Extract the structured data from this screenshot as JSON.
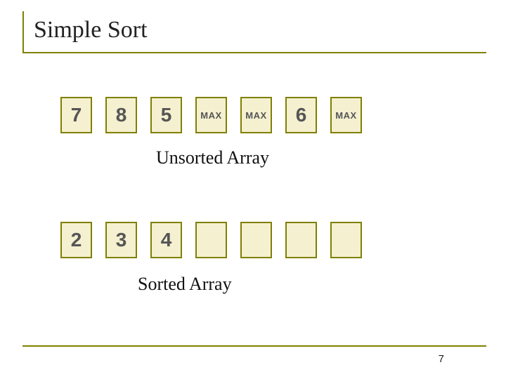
{
  "title": "Simple Sort",
  "unsorted": {
    "caption": "Unsorted Array",
    "cells": [
      {
        "kind": "num",
        "value": "7"
      },
      {
        "kind": "num",
        "value": "8"
      },
      {
        "kind": "num",
        "value": "5"
      },
      {
        "kind": "max",
        "value": "MAX"
      },
      {
        "kind": "max",
        "value": "MAX"
      },
      {
        "kind": "num",
        "value": "6"
      },
      {
        "kind": "max",
        "value": "MAX"
      }
    ]
  },
  "sorted": {
    "caption": "Sorted Array",
    "cells": [
      {
        "kind": "num",
        "value": "2"
      },
      {
        "kind": "num",
        "value": "3"
      },
      {
        "kind": "num",
        "value": "4"
      },
      {
        "kind": "empty",
        "value": ""
      },
      {
        "kind": "empty",
        "value": ""
      },
      {
        "kind": "empty",
        "value": ""
      },
      {
        "kind": "empty",
        "value": ""
      }
    ]
  },
  "page_number": "7",
  "chart_data": {
    "type": "table",
    "title": "Simple Sort — state snapshot",
    "arrays": {
      "unsorted": [
        "7",
        "8",
        "5",
        "MAX",
        "MAX",
        "6",
        "MAX"
      ],
      "sorted": [
        "2",
        "3",
        "4",
        "",
        "",
        "",
        ""
      ]
    }
  }
}
